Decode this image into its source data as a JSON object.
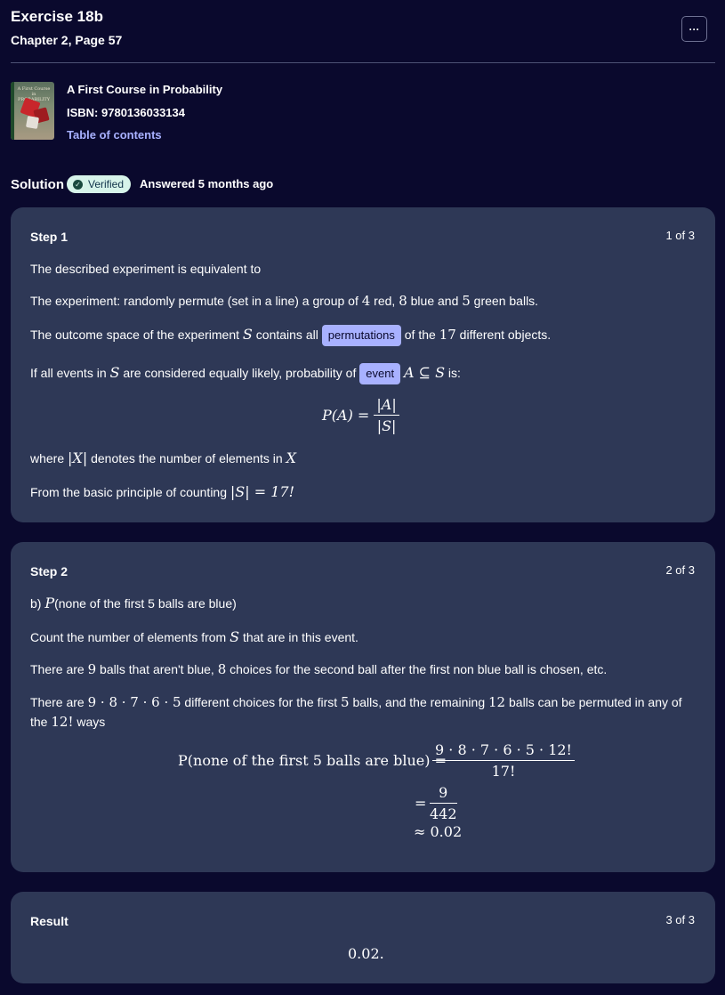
{
  "header": {
    "title": "Exercise 18b",
    "subtitle": "Chapter 2, Page 57",
    "more_label": "···"
  },
  "book": {
    "cover_text": "A First Course in PROBABILITY",
    "title": "A First Course in Probability",
    "isbn": "ISBN: 9780136033134",
    "toc_link": "Table of contents"
  },
  "solution": {
    "label": "Solution",
    "badge": "Verified",
    "answered": "Answered 5 months ago"
  },
  "steps": [
    {
      "title": "Step 1",
      "count": "1 of 3",
      "p1": "The described experiment is equivalent to",
      "p2_a": "The experiment: randomly permute (set in a line) a group of ",
      "p2_n1": "4",
      "p2_b": " red, ",
      "p2_n2": "8",
      "p2_c": " blue and ",
      "p2_n3": "5",
      "p2_d": " green balls.",
      "p3_a": "The outcome space of the experiment ",
      "p3_s": "S",
      "p3_b": " contains all ",
      "p3_chip": "permutations",
      "p3_c": " of the ",
      "p3_n": "17",
      "p3_d": " different objects.",
      "p4_a": "If all events in ",
      "p4_s": "S",
      "p4_b": " are considered equally likely, probability of ",
      "p4_chip": "event",
      "p4_math": "A ⊆ S",
      "p4_c": " is:",
      "f_lhs": "P(A) =",
      "f_num": "|A|",
      "f_den": "|S|",
      "p5_a": "where ",
      "p5_x": "|X|",
      "p5_b": " denotes the number of elements in ",
      "p5_x2": "X",
      "p6_a": "From the basic principle of counting ",
      "p6_math": "|S| = 17!"
    },
    {
      "title": "Step 2",
      "count": "2 of 3",
      "p1_a": "b) ",
      "p1_p": "P",
      "p1_b": "(none of the first 5 balls are blue)",
      "p2_a": "Count the number of elements from ",
      "p2_s": "S",
      "p2_b": " that are in this event.",
      "p3_a": "There are ",
      "p3_n1": "9",
      "p3_b": " balls that aren't blue, ",
      "p3_n2": "8",
      "p3_c": " choices for the second ball after the first non blue ball is chosen, etc.",
      "p4_a": "There are ",
      "p4_m": "9 · 8 · 7 · 6 · 5",
      "p4_b": " different choices for the first ",
      "p4_n": "5",
      "p4_c": " balls, and the remaining ",
      "p4_n2": "12",
      "p4_d": " balls can be permuted in any of the ",
      "p4_f": "12!",
      "p4_e": " ways",
      "f_lhs": "P(none of the first 5 balls are blue) =",
      "f1_num": "9 · 8 · 7 · 6 · 5 · 12!",
      "f1_den": "17!",
      "f2_eq": "=",
      "f2_num": "9",
      "f2_den": "442",
      "f3": "≈ 0.02"
    },
    {
      "title": "Result",
      "count": "3 of 3",
      "value": "0.02."
    }
  ],
  "colors": {
    "background": "#0a092d",
    "card": "#2e3856",
    "chip": "#a8b1ff",
    "badge": "#d7f4ea",
    "link": "#a8b1ff"
  }
}
